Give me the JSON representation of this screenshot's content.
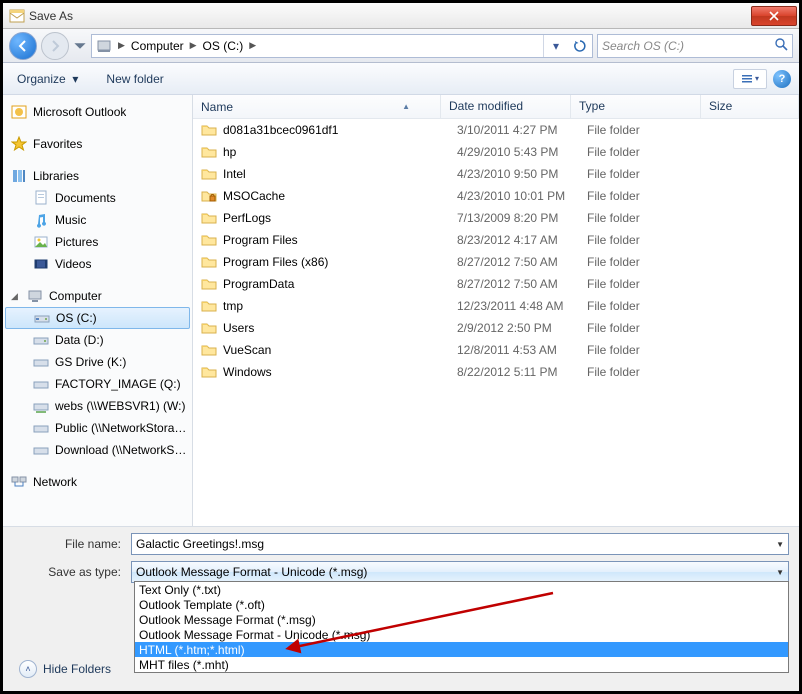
{
  "window": {
    "title": "Save As"
  },
  "nav": {
    "breadcrumb": [
      "Computer",
      "OS (C:)"
    ],
    "search_placeholder": "Search OS (C:)"
  },
  "toolbar": {
    "organize": "Organize",
    "newfolder": "New folder"
  },
  "columns": {
    "name": "Name",
    "date": "Date modified",
    "type": "Type",
    "size": "Size"
  },
  "favorites": {
    "outlook": "Microsoft Outlook",
    "favorites": "Favorites"
  },
  "libraries": {
    "header": "Libraries",
    "documents": "Documents",
    "music": "Music",
    "pictures": "Pictures",
    "videos": "Videos"
  },
  "computer": {
    "header": "Computer",
    "osc": "OS (C:)",
    "data": "Data (D:)",
    "gsdrive": "GS Drive (K:)",
    "factory": "FACTORY_IMAGE (Q:)",
    "webs": "webs (\\\\WEBSVR1) (W:)",
    "public": "Public (\\\\NetworkStorage)",
    "download": "Download (\\\\NetworkStorage)"
  },
  "network": {
    "header": "Network"
  },
  "files": [
    {
      "name": "d081a31bcec0961df1",
      "date": "3/10/2011 4:27 PM",
      "type": "File folder"
    },
    {
      "name": "hp",
      "date": "4/29/2010 5:43 PM",
      "type": "File folder"
    },
    {
      "name": "Intel",
      "date": "4/23/2010 9:50 PM",
      "type": "File folder"
    },
    {
      "name": "MSOCache",
      "date": "4/23/2010 10:01 PM",
      "type": "File folder",
      "locked": true
    },
    {
      "name": "PerfLogs",
      "date": "7/13/2009 8:20 PM",
      "type": "File folder"
    },
    {
      "name": "Program Files",
      "date": "8/23/2012 4:17 AM",
      "type": "File folder"
    },
    {
      "name": "Program Files (x86)",
      "date": "8/27/2012 7:50 AM",
      "type": "File folder"
    },
    {
      "name": "ProgramData",
      "date": "8/27/2012 7:50 AM",
      "type": "File folder"
    },
    {
      "name": "tmp",
      "date": "12/23/2011 4:48 AM",
      "type": "File folder"
    },
    {
      "name": "Users",
      "date": "2/9/2012 2:50 PM",
      "type": "File folder"
    },
    {
      "name": "VueScan",
      "date": "12/8/2011 4:53 AM",
      "type": "File folder"
    },
    {
      "name": "Windows",
      "date": "8/22/2012 5:11 PM",
      "type": "File folder"
    }
  ],
  "form": {
    "filename_label": "File name:",
    "filename_value": "Galactic Greetings!.msg",
    "saveastype_label": "Save as type:",
    "saveastype_value": "Outlook Message Format - Unicode (*.msg)",
    "options": [
      "Text Only (*.txt)",
      "Outlook Template (*.oft)",
      "Outlook Message Format (*.msg)",
      "Outlook Message Format - Unicode (*.msg)",
      "HTML (*.htm;*.html)",
      "MHT files (*.mht)"
    ],
    "selected_option_index": 4
  },
  "footer": {
    "hidefolders": "Hide Folders"
  }
}
